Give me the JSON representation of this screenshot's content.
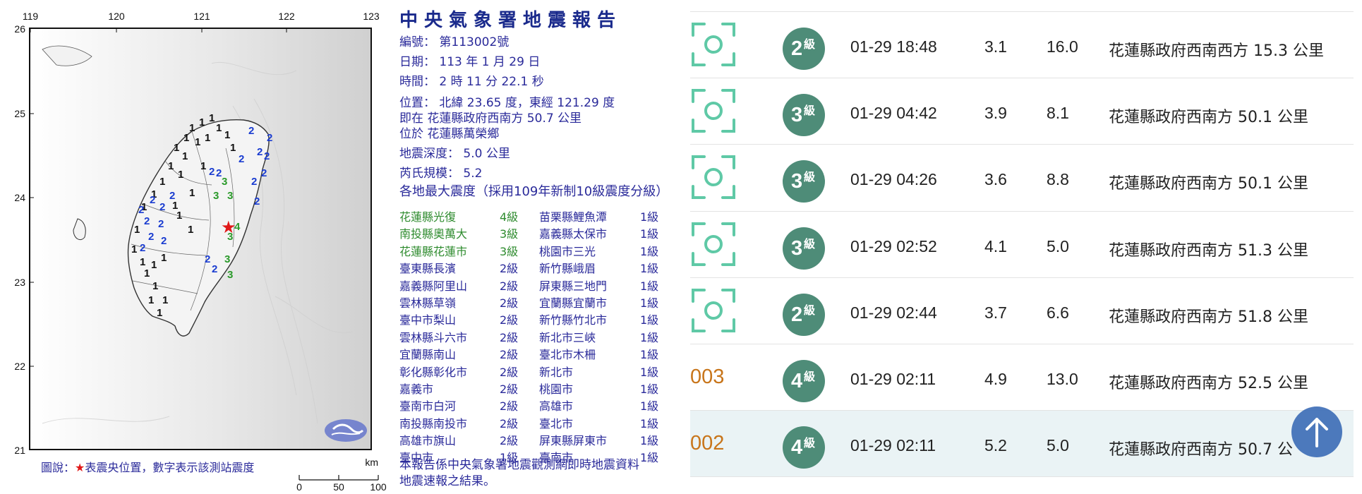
{
  "report": {
    "title": "中央氣象署地震報告",
    "lines": [
      "編號： 第113002號",
      "日期： 113 年 1 月 29 日",
      "時間： 2 時 11 分 22.1 秒",
      "位置： 北緯 23.65 度，東經 121.29 度",
      "即在 花蓮縣政府西南方 50.7 公里",
      "位於 花蓮縣萬榮鄉",
      "地震深度： 5.0 公里",
      "芮氏規模： 5.2",
      "各地最大震度（採用109年新制10級震度分級）"
    ],
    "intensity_rows": [
      [
        "花蓮縣光復",
        "4級",
        "苗栗縣鯉魚潭",
        "1級"
      ],
      [
        "南投縣奧萬大",
        "3級",
        "嘉義縣太保市",
        "1級"
      ],
      [
        "花蓮縣花蓮市",
        "3級",
        "桃園市三光",
        "1級"
      ],
      [
        "臺東縣長濱",
        "2級",
        "新竹縣峨眉",
        "1級"
      ],
      [
        "嘉義縣阿里山",
        "2級",
        "屏東縣三地門",
        "1級"
      ],
      [
        "雲林縣草嶺",
        "2級",
        "宜蘭縣宜蘭市",
        "1級"
      ],
      [
        "臺中市梨山",
        "2級",
        "新竹縣竹北市",
        "1級"
      ],
      [
        "雲林縣斗六市",
        "2級",
        "新北市三峽",
        "1級"
      ],
      [
        "宜蘭縣南山",
        "2級",
        "臺北市木柵",
        "1級"
      ],
      [
        "彰化縣彰化市",
        "2級",
        "新北市",
        "1級"
      ],
      [
        "嘉義市",
        "2級",
        "桃園市",
        "1級"
      ],
      [
        "臺南市白河",
        "2級",
        "高雄市",
        "1級"
      ],
      [
        "南投縣南投市",
        "2級",
        "臺北市",
        "1級"
      ],
      [
        "高雄市旗山",
        "2級",
        "屏東縣屏東市",
        "1級"
      ],
      [
        "臺中市",
        "1級",
        "臺南市",
        "1級"
      ]
    ],
    "footnote": [
      "本報告係中央氣象署地震觀測網即時地震資料",
      "地震速報之結果。"
    ],
    "legend_prefix": "圖說：",
    "legend_star": "★",
    "legend_rest": "表震央位置，數字表示該測站震度",
    "axis_top": [
      "119",
      "120",
      "121",
      "122",
      "123"
    ],
    "axis_left": [
      "26",
      "25",
      "24",
      "23",
      "22",
      "21"
    ],
    "scale_labels": [
      "0",
      "50",
      "100"
    ],
    "scale_unit": "km"
  },
  "list": {
    "rows": [
      {
        "id": "",
        "icon": "focus-icon",
        "intensity": "2",
        "unit": "級",
        "time": "01-29 18:48",
        "mag": "3.1",
        "depth": "16.0",
        "location": "花蓮縣政府西南西方 15.3 公里"
      },
      {
        "id": "",
        "icon": "focus-icon",
        "intensity": "3",
        "unit": "級",
        "time": "01-29 04:42",
        "mag": "3.9",
        "depth": "8.1",
        "location": "花蓮縣政府西南方 50.1 公里"
      },
      {
        "id": "",
        "icon": "focus-icon",
        "intensity": "3",
        "unit": "級",
        "time": "01-29 04:26",
        "mag": "3.6",
        "depth": "8.8",
        "location": "花蓮縣政府西南方 50.1 公里"
      },
      {
        "id": "",
        "icon": "focus-icon",
        "intensity": "3",
        "unit": "級",
        "time": "01-29 02:52",
        "mag": "4.1",
        "depth": "5.0",
        "location": "花蓮縣政府西南方 51.3 公里"
      },
      {
        "id": "",
        "icon": "focus-icon",
        "intensity": "2",
        "unit": "級",
        "time": "01-29 02:44",
        "mag": "3.7",
        "depth": "6.6",
        "location": "花蓮縣政府西南方 51.8 公里"
      },
      {
        "id": "003",
        "icon": "",
        "intensity": "4",
        "unit": "級",
        "time": "01-29 02:11",
        "mag": "4.9",
        "depth": "13.0",
        "location": "花蓮縣政府西南方 52.5 公里"
      },
      {
        "id": "002",
        "icon": "",
        "intensity": "4",
        "unit": "級",
        "time": "01-29 02:11",
        "mag": "5.2",
        "depth": "5.0",
        "location": "花蓮縣政府西南方 50.7 公"
      }
    ],
    "scroll_top_icon": "arrow-up-icon"
  },
  "colors": {
    "intensity_badge": "#4e8c78",
    "id_number": "#c8751a",
    "focus_icon": "#5fc9a6",
    "scroll_button": "#3f6fb8",
    "report_text": "#2a2a9a"
  }
}
